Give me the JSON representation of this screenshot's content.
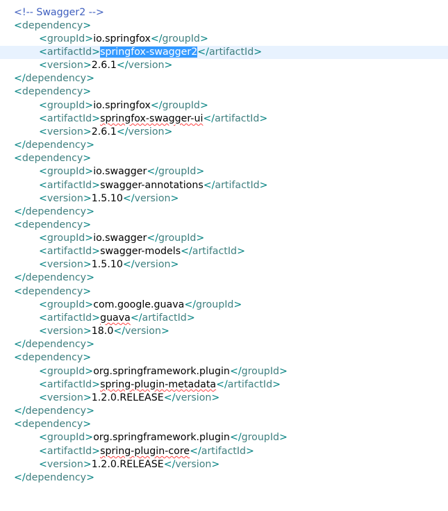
{
  "editor": {
    "comment": "<!-- Swagger2 -->",
    "dep_open": "dependency",
    "dep_close": "dependency",
    "tag_groupId": "groupId",
    "tag_artifactId": "artifactId",
    "tag_version": "version",
    "selected_text": "springfox-swagger2",
    "dependencies": [
      {
        "groupId": "io.springfox",
        "artifactId": "springfox-swagger2",
        "version": "2.6.1"
      },
      {
        "groupId": "io.springfox",
        "artifactId": "springfox-swagger-ui",
        "version": "2.6.1"
      },
      {
        "groupId": "io.swagger",
        "artifactId": "swagger-annotations",
        "version": "1.5.10"
      },
      {
        "groupId": "io.swagger",
        "artifactId": "swagger-models",
        "version": "1.5.10"
      },
      {
        "groupId": "com.google.guava",
        "artifactId": "guava",
        "version": "18.0"
      },
      {
        "groupId": "org.springframework.plugin",
        "artifactId": "spring-plugin-metadata",
        "version": "1.2.0.RELEASE"
      },
      {
        "groupId": "org.springframework.plugin",
        "artifactId": "spring-plugin-core",
        "version": "1.2.0.RELEASE"
      }
    ]
  },
  "colors": {
    "tag": "#3f7f7f",
    "bracket": "#008080",
    "comment": "#3f5fbf",
    "selection": "#3399ff",
    "current_line": "#e8f2fe"
  }
}
